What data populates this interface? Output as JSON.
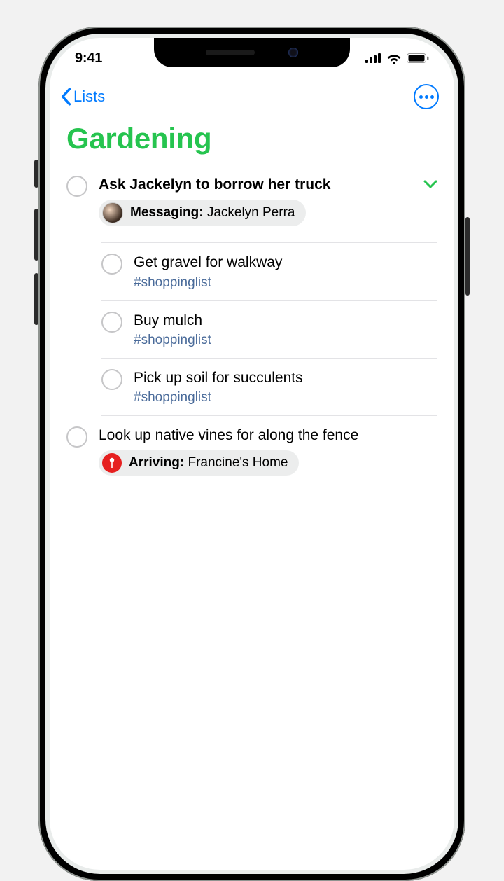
{
  "status": {
    "time": "9:41"
  },
  "nav": {
    "back_label": "Lists"
  },
  "title": "Gardening",
  "items": [
    {
      "title": "Ask Jackelyn to borrow her truck",
      "expanded": true,
      "badge": {
        "type": "messaging",
        "prefix": "Messaging:",
        "value": "Jackelyn Perra"
      },
      "children": [
        {
          "title": "Get gravel for walkway",
          "tag": "#shoppinglist"
        },
        {
          "title": "Buy mulch",
          "tag": "#shoppinglist"
        },
        {
          "title": "Pick up soil for succulents",
          "tag": "#shoppinglist"
        }
      ]
    },
    {
      "title": "Look up native vines for along the fence",
      "badge": {
        "type": "location",
        "prefix": "Arriving:",
        "value": "Francine's Home"
      }
    }
  ],
  "colors": {
    "accent": "#26c44f",
    "link": "#007aff",
    "tag": "#4a6b9a",
    "danger": "#e62020"
  }
}
